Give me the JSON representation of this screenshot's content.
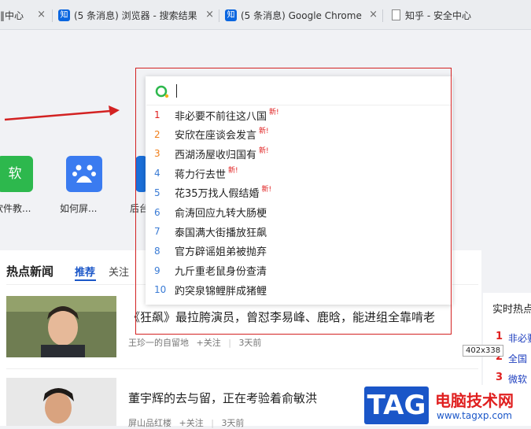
{
  "tabs": [
    {
      "label": "‖中心"
    },
    {
      "label": "(5 条消息) 浏览器 - 搜索结果"
    },
    {
      "label": "(5 条消息) Google Chrome"
    },
    {
      "label": "知乎 - 安全中心"
    }
  ],
  "zhihu_badge": "知",
  "shortcuts": [
    {
      "icon": "软",
      "label": "软件教..."
    },
    {
      "icon": "du",
      "label": "如何屏..."
    },
    {
      "icon": "",
      "label": "后台"
    }
  ],
  "suggestions": [
    {
      "rank": "1",
      "text": "非必要不前往这八国",
      "new": "新!"
    },
    {
      "rank": "2",
      "text": "安欣在座谈会发言",
      "new": "新!"
    },
    {
      "rank": "3",
      "text": "西湖汤屋收归国有",
      "new": "新!"
    },
    {
      "rank": "4",
      "text": "蒋力行去世",
      "new": "新!"
    },
    {
      "rank": "5",
      "text": "花35万找人假结婚",
      "new": "新!"
    },
    {
      "rank": "6",
      "text": "俞涛回应九转大肠梗",
      "new": ""
    },
    {
      "rank": "7",
      "text": "泰国满大街播放狂飙",
      "new": ""
    },
    {
      "rank": "8",
      "text": "官方辟谣姐弟被抛弃",
      "new": ""
    },
    {
      "rank": "9",
      "text": "九斤重老鼠身份查清",
      "new": ""
    },
    {
      "rank": "10",
      "text": "趵突泉锦鲤胖成猪鲤",
      "new": ""
    }
  ],
  "news": {
    "heading": "热点新闻",
    "tabs": [
      "推荐",
      "关注"
    ],
    "items": [
      {
        "title": "《狂飙》最拉胯演员，曾怼李易峰、鹿晗，能进组全靠啃老",
        "source": "王珍一的自留地",
        "follow": "+关注",
        "time": "3天前"
      },
      {
        "title": "董宇辉的去与留，正在考验着俞敏洪",
        "source": "屏山品红楼",
        "follow": "+关注",
        "time": "3天前"
      }
    ]
  },
  "hot": {
    "title": "实时热点",
    "items": [
      {
        "rank": "1",
        "text": "非必要"
      },
      {
        "rank": "2",
        "text": "全国"
      },
      {
        "rank": "3",
        "text": "微软"
      }
    ]
  },
  "size_label": "402x338",
  "watermark": {
    "tag": "TAG",
    "site": "电脑技术网",
    "url": "www.tagxp.com"
  },
  "colors": {
    "accent_red": "#d32222",
    "brand_blue": "#1a56c8",
    "rank_red": "#e02020",
    "rank_orange": "#f07f1a",
    "rank_blue": "#3a7bd5"
  }
}
